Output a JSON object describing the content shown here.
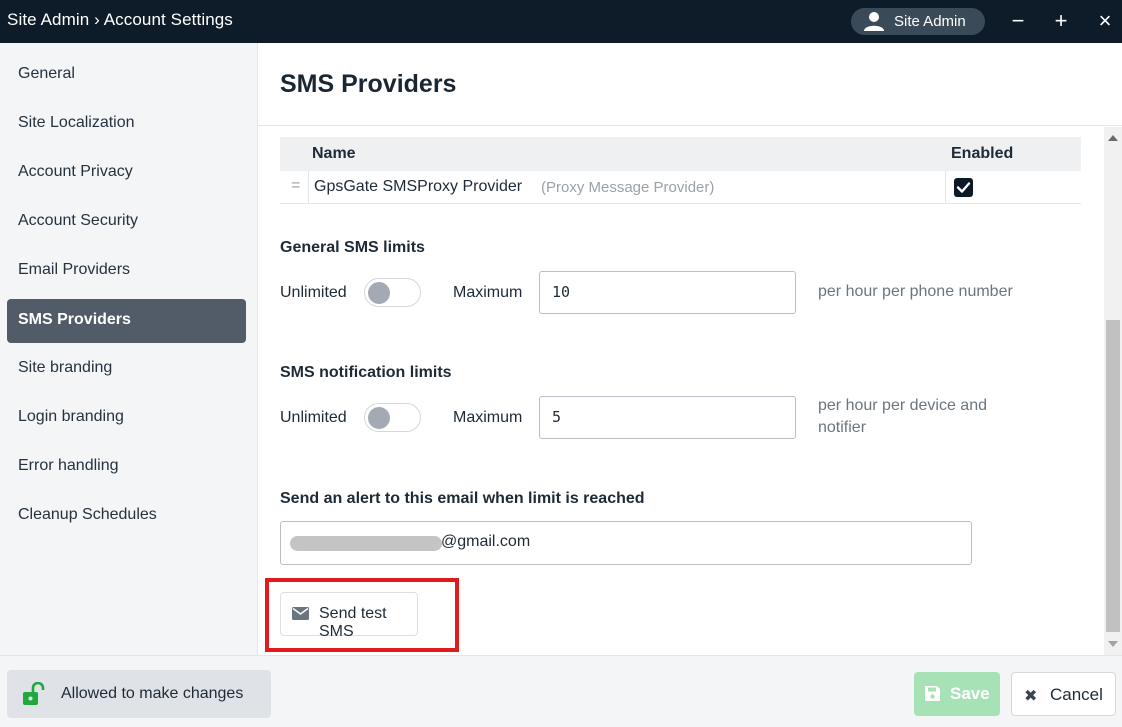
{
  "window": {
    "title": "Site Admin › Account Settings",
    "user_label": "Site Admin",
    "minimize_glyph": "−",
    "maximize_glyph": "+",
    "close_glyph": "×"
  },
  "sidebar": {
    "items": [
      {
        "label": "General"
      },
      {
        "label": "Site Localization"
      },
      {
        "label": "Account Privacy"
      },
      {
        "label": "Account Security"
      },
      {
        "label": "Email Providers"
      },
      {
        "label": "SMS Providers",
        "active": true
      },
      {
        "label": "Site branding"
      },
      {
        "label": "Login branding"
      },
      {
        "label": "Error handling"
      },
      {
        "label": "Cleanup Schedules"
      }
    ]
  },
  "main": {
    "title": "SMS Providers",
    "table": {
      "headers": {
        "name": "Name",
        "enabled": "Enabled"
      },
      "rows": [
        {
          "drag_glyph": "=",
          "name": "GpsGate SMSProxy Provider",
          "description": "(Proxy Message Provider)",
          "enabled": true
        }
      ]
    },
    "general_limits": {
      "title": "General SMS limits",
      "unlimited_label": "Unlimited",
      "unlimited_on": false,
      "maximum_label": "Maximum",
      "maximum_value": "10",
      "hint": "per hour per phone number"
    },
    "notification_limits": {
      "title": "SMS notification limits",
      "unlimited_label": "Unlimited",
      "unlimited_on": false,
      "maximum_label": "Maximum",
      "maximum_value": "5",
      "hint_line1": "per hour per device and",
      "hint_line2": "notifier"
    },
    "alert": {
      "title": "Send an alert to this email when limit is reached",
      "email_visible": "@gmail.com"
    },
    "test_button_label": "Send test SMS"
  },
  "footer": {
    "permission_label": "Allowed to make changes",
    "save_label": "Save",
    "cancel_label": "Cancel"
  },
  "colors": {
    "titlebar": "#0e1c2a",
    "active_nav": "#525c69",
    "save_disabled": "#a6e2b6",
    "highlight_red": "#e01b1b",
    "lock_green": "#1fa83c"
  },
  "icons": [
    "user-icon",
    "minimize-icon",
    "maximize-icon",
    "close-icon",
    "drag-handle-icon",
    "checkmark-icon",
    "envelope-icon",
    "unlocked-lock-icon",
    "floppy-disk-icon",
    "x-icon"
  ]
}
